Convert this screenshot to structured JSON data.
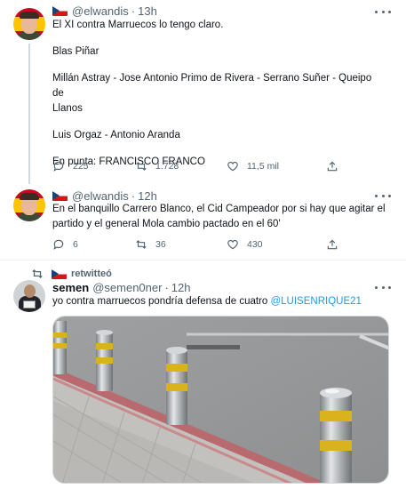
{
  "tweets": [
    {
      "flag": "czech-flag",
      "handle": "@elwandis",
      "time": "13h",
      "lines": [
        "El XI contra Marruecos lo tengo claro.",
        "",
        "Blas Piñar",
        "",
        "Millán Astray - Jose Antonio Primo de Rivera - Serrano Suñer - Queipo de",
        "Llanos",
        "",
        "Luis Orgaz - Antonio Aranda",
        "",
        "En punta: FRANCISCO FRANCO"
      ],
      "replies": "225",
      "retweets": "1.728",
      "likes": "11,5 mil"
    },
    {
      "flag": "czech-flag",
      "handle": "@elwandis",
      "time": "12h",
      "lines": [
        "En el banquillo Carrero Blanco, el Cid Campeador por si hay que agitar el",
        "partido y el general Mola cambio pactado en el 60'"
      ],
      "replies": "6",
      "retweets": "36",
      "likes": "430"
    }
  ],
  "retweeted": {
    "label": "retwitteó",
    "display_name": "semen",
    "handle": "@semen0ner",
    "time": "12h",
    "text": "yo contra marruecos pondría defensa de cuatro ",
    "mention": "@LUISENRIQUE21"
  },
  "colors": {
    "accent": "#1d9bf0",
    "muted": "#536471",
    "text": "#0f1419",
    "divider": "#eff3f4"
  }
}
